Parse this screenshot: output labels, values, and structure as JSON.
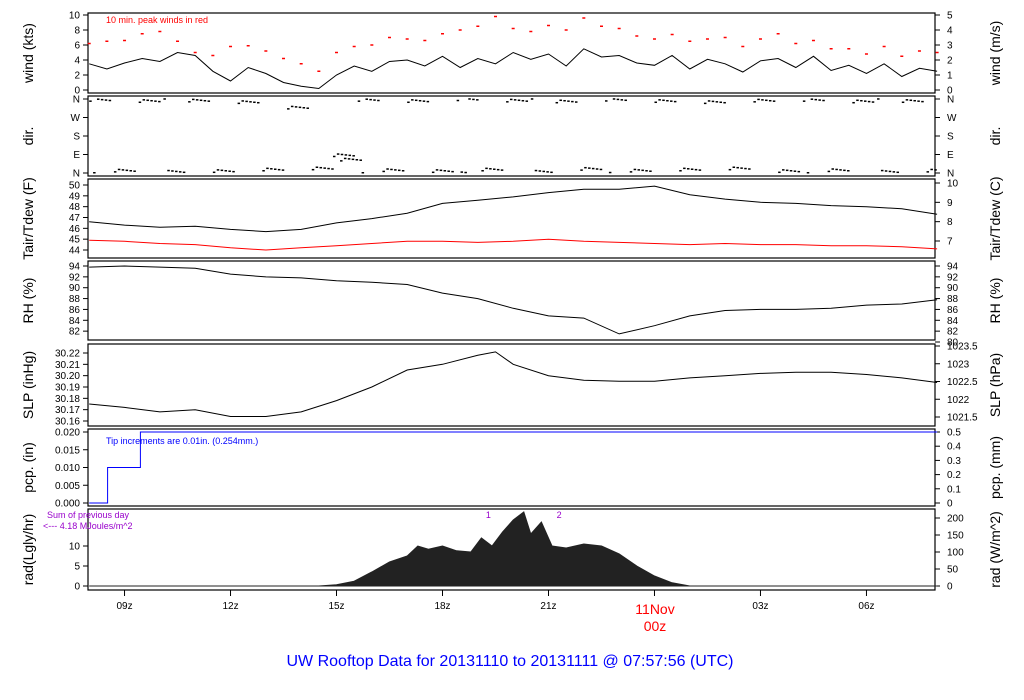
{
  "chart_data": [
    {
      "id": "wind",
      "type": "line",
      "ylabel": "wind (kts)",
      "ylabel_right": "wind (m/s)",
      "ylim": [
        0,
        10
      ],
      "yticks": [
        "0",
        "2",
        "4",
        "6",
        "8",
        "10"
      ],
      "right_ylim": [
        0,
        5
      ],
      "right_yticks": [
        "0",
        "1",
        "2",
        "3",
        "4",
        "5"
      ],
      "annotation": "10 min. peak winds in red",
      "x_hours": [
        8,
        8.5,
        9,
        9.5,
        10,
        10.5,
        11,
        11.5,
        12,
        12.5,
        13,
        13.5,
        14,
        14.5,
        15,
        15.5,
        16,
        16.5,
        17,
        17.5,
        18,
        18.5,
        19,
        19.5,
        20,
        20.5,
        21,
        21.5,
        22,
        22.5,
        23,
        23.5,
        24,
        24.5,
        25,
        25.5,
        26,
        26.5,
        27,
        27.5,
        28,
        28.5,
        29,
        29.5,
        30,
        30.5,
        31,
        31.5,
        32
      ],
      "series": [
        {
          "name": "wind",
          "color": "#000000",
          "values": [
            3.5,
            2.8,
            3.6,
            4.2,
            3.8,
            5.0,
            4.6,
            2.5,
            1.2,
            3.0,
            2.2,
            1.0,
            0.5,
            0.2,
            2.0,
            3.2,
            2.5,
            3.8,
            4.0,
            3.2,
            4.5,
            3.0,
            4.2,
            3.5,
            5.0,
            4.1,
            4.8,
            3.2,
            5.5,
            4.4,
            4.6,
            3.6,
            3.3,
            4.6,
            2.8,
            4.1,
            3.5,
            2.4,
            3.9,
            4.2,
            3.0,
            4.5,
            2.6,
            3.3,
            2.2,
            3.5,
            1.8,
            2.9,
            2.5
          ]
        },
        {
          "name": "peak",
          "color": "#ff0000",
          "values": [
            6.2,
            6.5,
            6.6,
            7.5,
            7.8,
            6.5,
            5.0,
            4.6,
            5.8,
            5.9,
            5.2,
            4.2,
            3.5,
            2.5,
            5.0,
            5.8,
            6.0,
            7.0,
            6.8,
            6.6,
            7.5,
            8.0,
            8.5,
            9.8,
            8.2,
            7.8,
            8.6,
            8.0,
            9.6,
            8.5,
            8.2,
            7.2,
            6.8,
            7.4,
            6.5,
            6.8,
            7.0,
            5.8,
            6.8,
            7.5,
            6.2,
            6.6,
            5.5,
            5.5,
            4.8,
            5.8,
            4.5,
            5.2,
            5.0
          ]
        }
      ]
    },
    {
      "id": "dir",
      "type": "scatter",
      "ylabel": "dir.",
      "ylabel_right": "dir.",
      "yticks": [
        "N",
        "E",
        "S",
        "W",
        "N"
      ],
      "ylim": [
        0,
        360
      ],
      "x_hours": [
        8,
        8.7,
        9.4,
        10.1,
        10.8,
        11.5,
        12.2,
        12.9,
        13.6,
        14.3,
        14.9,
        15.1,
        15.6,
        16.3,
        17,
        17.7,
        18.4,
        19.1,
        19.8,
        20.5,
        21.2,
        21.9,
        22.6,
        23.3,
        24,
        24.7,
        25.4,
        26.1,
        26.8,
        27.5,
        28.2,
        28.9,
        29.6,
        30.3,
        31,
        31.7
      ],
      "values": [
        355,
        10,
        350,
        5,
        352,
        8,
        345,
        15,
        320,
        20,
        80,
        60,
        355,
        12,
        350,
        8,
        358,
        15,
        352,
        5,
        348,
        18,
        356,
        10,
        350,
        15,
        345,
        20,
        352,
        8,
        355,
        12,
        348,
        5,
        350,
        10
      ]
    },
    {
      "id": "temp",
      "type": "line",
      "ylabel": "Tair/Tdew (F)",
      "ylabel_right": "Tair/Tdew (C)",
      "ylim": [
        43.6,
        50.3
      ],
      "yticks": [
        "44",
        "45",
        "46",
        "47",
        "48",
        "49",
        "50"
      ],
      "right_yticks": [
        "7",
        "8",
        "9",
        "10"
      ],
      "x_hours": [
        8,
        9,
        10,
        11,
        12,
        13,
        14,
        15,
        16,
        17,
        18,
        19,
        20,
        21,
        22,
        23,
        24,
        25,
        26,
        27,
        28,
        29,
        30,
        31,
        32
      ],
      "series": [
        {
          "name": "Tair",
          "color": "#000000",
          "values": [
            46.6,
            46.3,
            46.1,
            46.2,
            45.9,
            45.7,
            45.9,
            46.5,
            46.9,
            47.4,
            48.3,
            48.6,
            48.9,
            49.3,
            49.6,
            49.6,
            49.9,
            49.1,
            48.7,
            48.4,
            48.3,
            48.1,
            48.0,
            47.8,
            47.3
          ]
        },
        {
          "name": "Tdew",
          "color": "#ff0000",
          "values": [
            44.9,
            44.8,
            44.6,
            44.5,
            44.2,
            44.0,
            44.2,
            44.4,
            44.6,
            44.8,
            44.8,
            44.7,
            44.8,
            45.0,
            44.8,
            44.7,
            44.6,
            44.5,
            44.6,
            44.5,
            44.5,
            44.4,
            44.4,
            44.3,
            44.1
          ]
        }
      ]
    },
    {
      "id": "rh",
      "type": "line",
      "ylabel": "RH (%)",
      "ylabel_right": "RH (%)",
      "ylim": [
        80,
        94.5
      ],
      "yticks": [
        "82",
        "84",
        "86",
        "88",
        "90",
        "92",
        "94"
      ],
      "right_yticks": [
        "80",
        "82",
        "84",
        "86",
        "88",
        "90",
        "92",
        "94"
      ],
      "x_hours": [
        8,
        9,
        10,
        11,
        12,
        13,
        14,
        15,
        16,
        17,
        18,
        19,
        20,
        21,
        22,
        23,
        24,
        25,
        26,
        27,
        28,
        29,
        30,
        31,
        32
      ],
      "series": [
        {
          "name": "RH",
          "color": "#000000",
          "values": [
            93.8,
            94,
            93.8,
            93.6,
            92.5,
            92,
            91.8,
            91.3,
            91,
            90.6,
            89,
            88,
            86.2,
            84.8,
            84.4,
            81.5,
            83,
            84.8,
            85.8,
            86,
            86,
            86.2,
            86.8,
            87,
            87.8
          ]
        }
      ]
    },
    {
      "id": "slp",
      "type": "line",
      "ylabel": "SLP (inHg)",
      "ylabel_right": "SLP (hPa)",
      "ylim": [
        30.16,
        30.225
      ],
      "yticks": [
        "30.16",
        "30.17",
        "30.18",
        "30.19",
        "30.20",
        "30.21",
        "30.22"
      ],
      "right_yticks": [
        "1021.5",
        "1022",
        "1022.5",
        "1023",
        "1023.5"
      ],
      "x_hours": [
        8,
        9,
        10,
        11,
        12,
        13,
        14,
        15,
        16,
        17,
        18,
        19,
        19.5,
        20,
        21,
        22,
        23,
        24,
        25,
        26,
        27,
        28,
        29,
        30,
        31,
        32
      ],
      "series": [
        {
          "name": "SLP",
          "color": "#000000",
          "values": [
            30.175,
            30.172,
            30.168,
            30.17,
            30.164,
            30.164,
            30.168,
            30.178,
            30.19,
            30.205,
            30.21,
            30.218,
            30.221,
            30.21,
            30.2,
            30.196,
            30.195,
            30.195,
            30.198,
            30.2,
            30.202,
            30.203,
            30.203,
            30.201,
            30.198,
            30.194
          ]
        }
      ]
    },
    {
      "id": "pcp",
      "type": "line",
      "ylabel": "pcp. (in)",
      "ylabel_right": "pcp. (mm)",
      "ylim": [
        0,
        0.02
      ],
      "yticks": [
        "0.000",
        "0.005",
        "0.010",
        "0.015",
        "0.020"
      ],
      "right_yticks": [
        "0",
        "0.1",
        "0.2",
        "0.3",
        "0.4",
        "0.5"
      ],
      "annotation": "Tip increments are 0.01in. (0.254mm.)",
      "x_hours": [
        8,
        8.52,
        8.52,
        9.45,
        9.45,
        32
      ],
      "series": [
        {
          "name": "pcp",
          "color": "#0000ff",
          "values": [
            0,
            0,
            0.01,
            0.01,
            0.02,
            0.02
          ]
        }
      ]
    },
    {
      "id": "rad",
      "type": "area",
      "ylabel": "rad(Lgly/hr)",
      "ylabel_right": "rad (W/m^2)",
      "ylim": [
        0,
        17
      ],
      "yticks": [
        "0",
        "5",
        "10"
      ],
      "right_yticks": [
        "0",
        "50",
        "100",
        "150",
        "200"
      ],
      "annotation_line1": "Sum of previous day",
      "annotation_line2": "<--- 4.18 MJoules/m^2",
      "markers": [
        "1",
        "2"
      ],
      "marker_hours": [
        19.3,
        21.3
      ],
      "x_hours": [
        8,
        14.5,
        15,
        15.5,
        16,
        16.5,
        17,
        17.3,
        17.6,
        18,
        18.4,
        18.8,
        19.1,
        19.4,
        19.7,
        20,
        20.3,
        20.5,
        20.8,
        21.1,
        21.5,
        22,
        22.5,
        23,
        23.5,
        24,
        24.5,
        25,
        32
      ],
      "series": [
        {
          "name": "rad",
          "color": "#222222",
          "values": [
            0,
            0,
            0.3,
            1.2,
            3.5,
            6,
            7.5,
            10,
            9.2,
            10,
            8.8,
            8.5,
            12,
            10,
            13.5,
            16.5,
            18.5,
            13,
            16,
            10,
            9.5,
            10.5,
            10,
            8,
            5,
            2.5,
            0.8,
            0,
            0
          ]
        }
      ]
    }
  ],
  "x_axis": {
    "ticks": [
      "09z",
      "12z",
      "15z",
      "18z",
      "21z",
      "03z",
      "06z"
    ],
    "tick_hours": [
      9,
      12,
      15,
      18,
      21,
      27,
      30
    ],
    "day_label": "11Nov",
    "day_tick": "00z"
  },
  "title": "UW Rooftop Data for 20131110  to  20131111 @ 07:57:56  (UTC)"
}
